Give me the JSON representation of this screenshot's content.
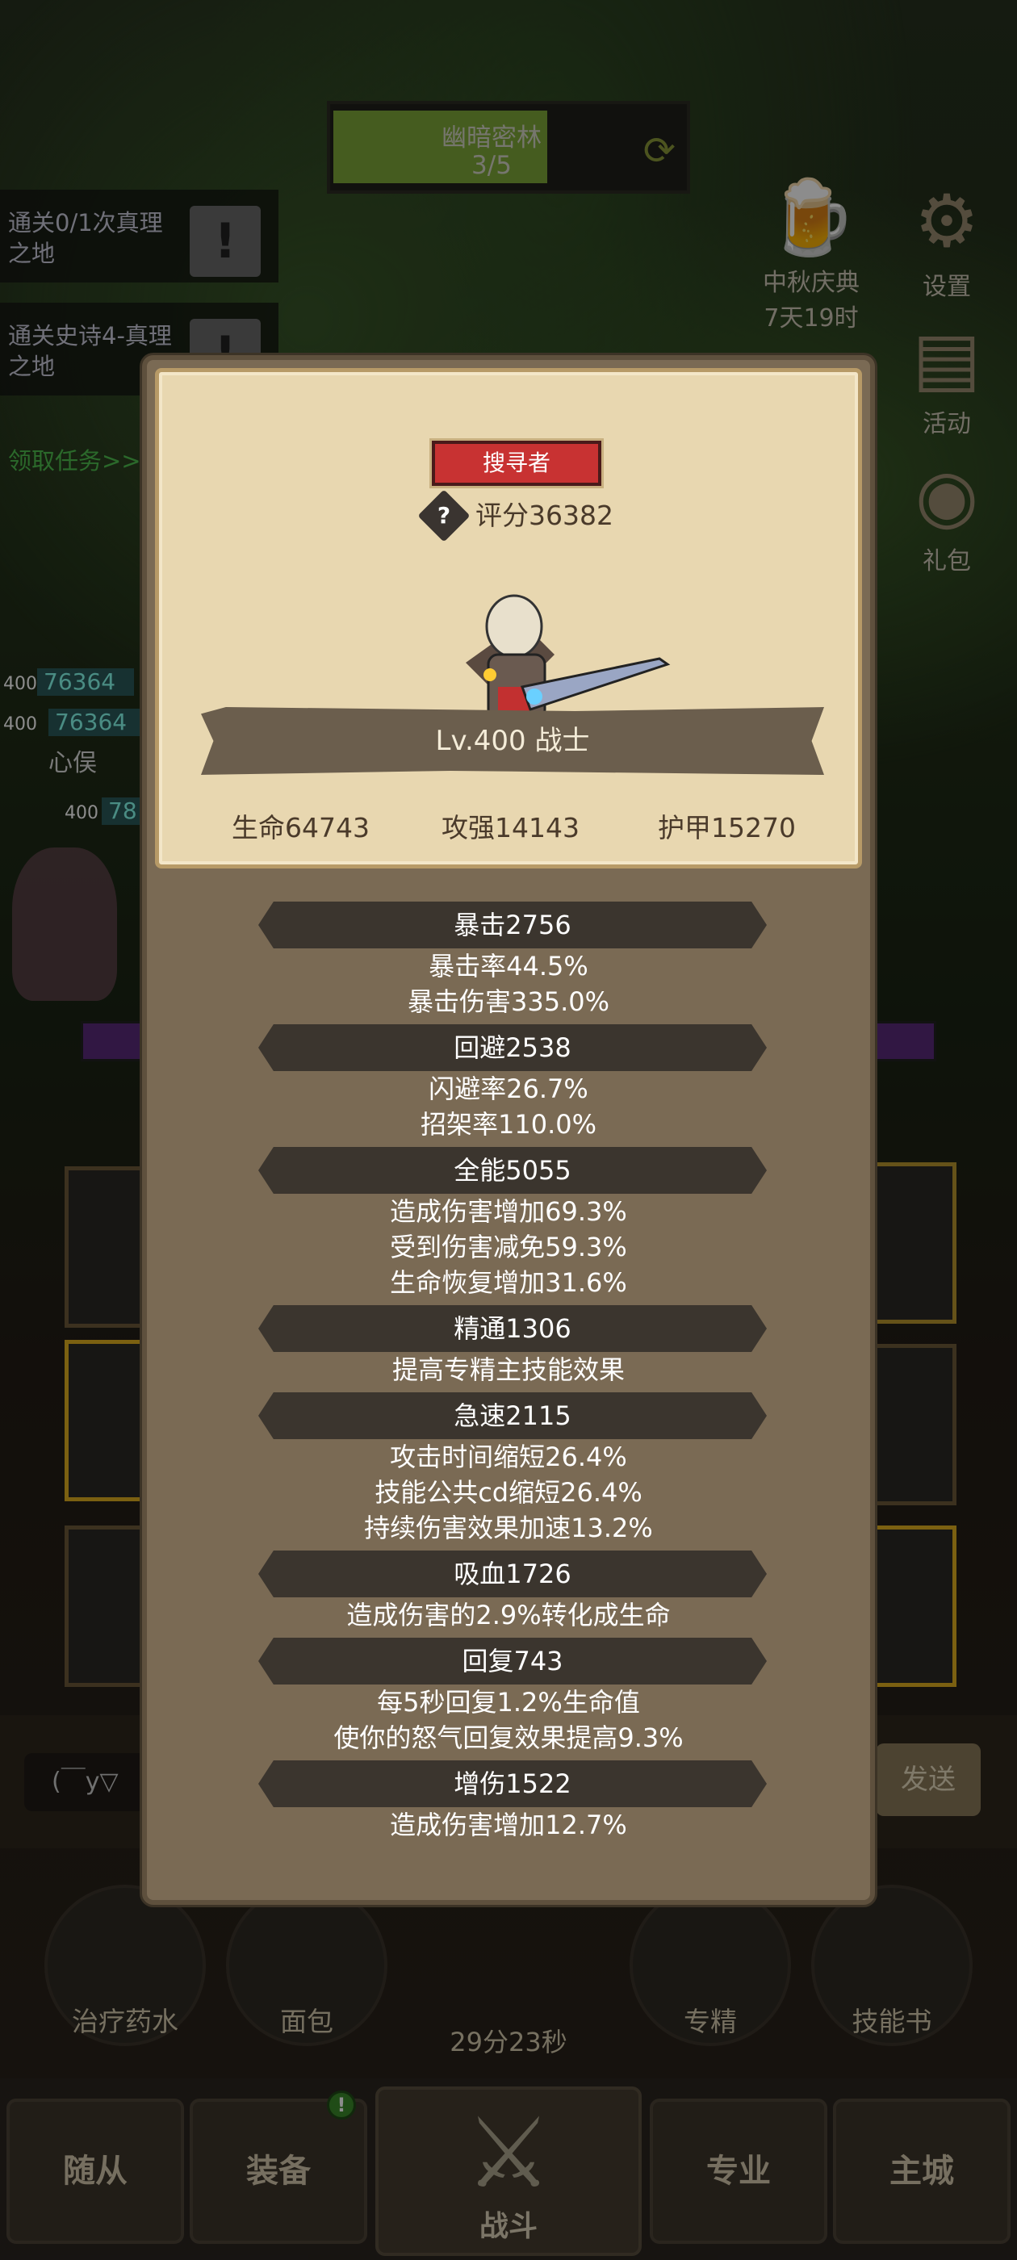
{
  "stage": {
    "name": "幽暗密林",
    "progress": "3/5",
    "progress_fraction": 0.6
  },
  "quests": [
    {
      "text": "通关0/1次真理之地",
      "icon": "exclamation-icon"
    },
    {
      "text": "通关史诗4-真理之地",
      "icon": "exclamation-icon"
    }
  ],
  "quest_link": "领取任务>>",
  "top_right": {
    "festival": {
      "label": "中秋庆典",
      "timer": "7天19时"
    },
    "settings": "设置",
    "events": "活动",
    "gift": "礼包"
  },
  "battle": {
    "hp_values": [
      "76364",
      "76364"
    ],
    "level_tags": [
      "400",
      "400",
      "400"
    ],
    "partial_hp": "78",
    "partial_text": "心俣"
  },
  "chat": {
    "input": "(￣y▽",
    "send": "发送"
  },
  "items": [
    {
      "label": "治疗药水",
      "icon": "potion-icon"
    },
    {
      "label": "面包",
      "icon": "bread-icon"
    },
    {
      "label": "专精",
      "icon": "spec-icon"
    },
    {
      "label": "技能书",
      "icon": "skillbook-icon"
    }
  ],
  "chest_timer": "29分23秒",
  "nav": {
    "followers": "随从",
    "equipment": "装备",
    "battle": "战斗",
    "profession": "专业",
    "city": "主城",
    "badge": "!"
  },
  "character": {
    "rank": "搜寻者",
    "score": "评分36382",
    "level_class": "Lv.400 战士",
    "hp": "生命64743",
    "attack": "攻强14143",
    "armor": "护甲15270"
  },
  "attributes": [
    {
      "title": "暴击2756",
      "details": [
        "暴击率44.5%",
        "暴击伤害335.0%"
      ]
    },
    {
      "title": "回避2538",
      "details": [
        "闪避率26.7%",
        "招架率110.0%"
      ]
    },
    {
      "title": "全能5055",
      "details": [
        "造成伤害增加69.3%",
        "受到伤害减免59.3%",
        "生命恢复增加31.6%"
      ]
    },
    {
      "title": "精通1306",
      "details": [
        "提高专精主技能效果"
      ]
    },
    {
      "title": "急速2115",
      "details": [
        "攻击时间缩短26.4%",
        "技能公共cd缩短26.4%",
        "持续伤害效果加速13.2%"
      ]
    },
    {
      "title": "吸血1726",
      "details": [
        "造成伤害的2.9%转化成生命"
      ]
    },
    {
      "title": "回复743",
      "details": [
        "每5秒回复1.2%生命值",
        "使你的怒气回复效果提高9.3%"
      ]
    },
    {
      "title": "增伤1522",
      "details": [
        "造成伤害增加12.7%"
      ]
    }
  ]
}
